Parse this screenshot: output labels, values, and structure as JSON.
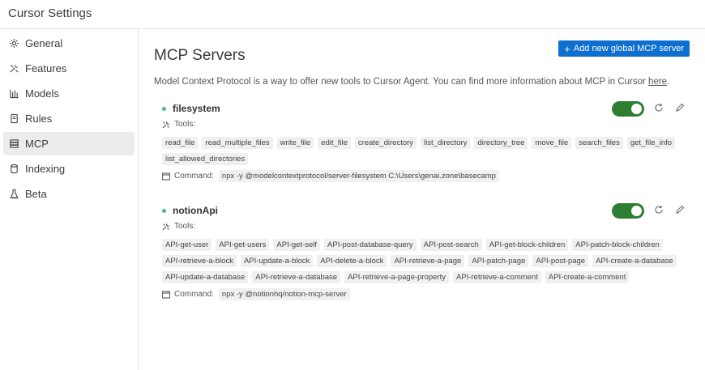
{
  "window": {
    "title": "Cursor Settings"
  },
  "sidebar": {
    "items": [
      {
        "label": "General",
        "icon": "gear-icon"
      },
      {
        "label": "Features",
        "icon": "tools-icon"
      },
      {
        "label": "Models",
        "icon": "models-icon"
      },
      {
        "label": "Rules",
        "icon": "document-icon"
      },
      {
        "label": "MCP",
        "icon": "server-icon",
        "active": true
      },
      {
        "label": "Indexing",
        "icon": "database-icon"
      },
      {
        "label": "Beta",
        "icon": "flask-icon"
      }
    ]
  },
  "main": {
    "title": "MCP Servers",
    "add_button": "Add new global MCP server",
    "description": "Model Context Protocol is a way to offer new tools to Cursor Agent. You can find more information about MCP in Cursor",
    "description_link": "here",
    "tools_label": "Tools:",
    "command_label": "Command:"
  },
  "servers": [
    {
      "name": "filesystem",
      "enabled": true,
      "status_color": "#4dbd74",
      "tools": [
        "read_file",
        "read_multiple_files",
        "write_file",
        "edit_file",
        "create_directory",
        "list_directory",
        "directory_tree",
        "move_file",
        "search_files",
        "get_file_info",
        "list_allowed_directories"
      ],
      "command": "npx -y @modelcontextprotocol/server-filesystem C:\\Users\\genai.zone\\basecamp"
    },
    {
      "name": "notionApi",
      "enabled": true,
      "status_color": "#4dbd74",
      "tools": [
        "API-get-user",
        "API-get-users",
        "API-get-self",
        "API-post-database-query",
        "API-post-search",
        "API-get-block-children",
        "API-patch-block-children",
        "API-retrieve-a-block",
        "API-update-a-block",
        "API-delete-a-block",
        "API-retrieve-a-page",
        "API-patch-page",
        "API-post-page",
        "API-create-a-database",
        "API-update-a-database",
        "API-retrieve-a-database",
        "API-retrieve-a-page-property",
        "API-retrieve-a-comment",
        "API-create-a-comment"
      ],
      "command": "npx -y @notionhq/notion-mcp-server"
    }
  ],
  "colors": {
    "accent": "#0e6fcf",
    "toggle_on": "#2e7d32",
    "status": "#4dbd74"
  }
}
